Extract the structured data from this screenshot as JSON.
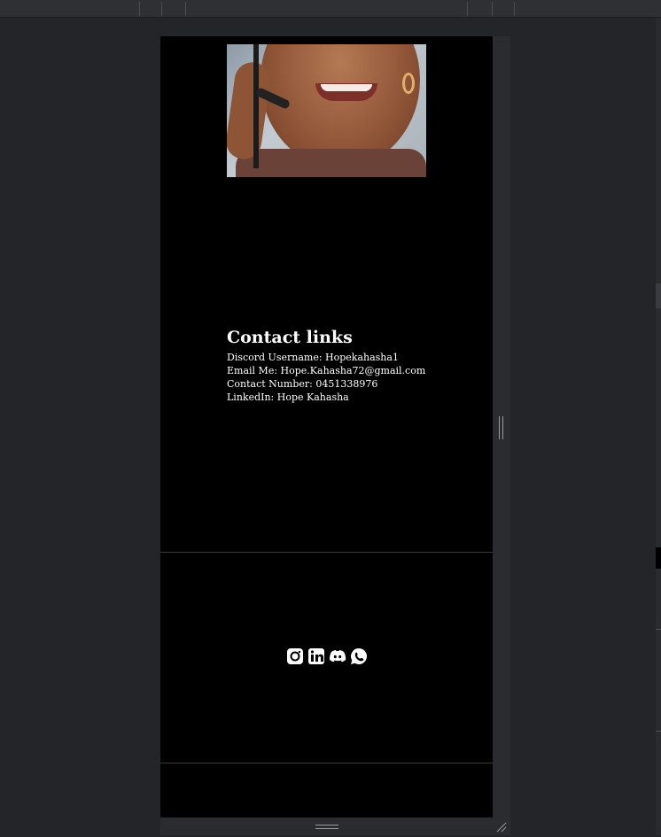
{
  "contact": {
    "title": "Contact links",
    "lines": [
      "Discord Username: Hopekahasha1",
      "Email Me: Hope.Kahasha72@gmail.com",
      "Contact Number: 0451338976",
      "LinkedIn: Hope Kahasha"
    ]
  },
  "social": {
    "icons": [
      "instagram-icon",
      "linkedin-icon",
      "discord-icon",
      "whatsapp-icon"
    ]
  },
  "colors": {
    "page_background": "#000000",
    "editor_background": "#242528",
    "text": "#ffffff"
  }
}
